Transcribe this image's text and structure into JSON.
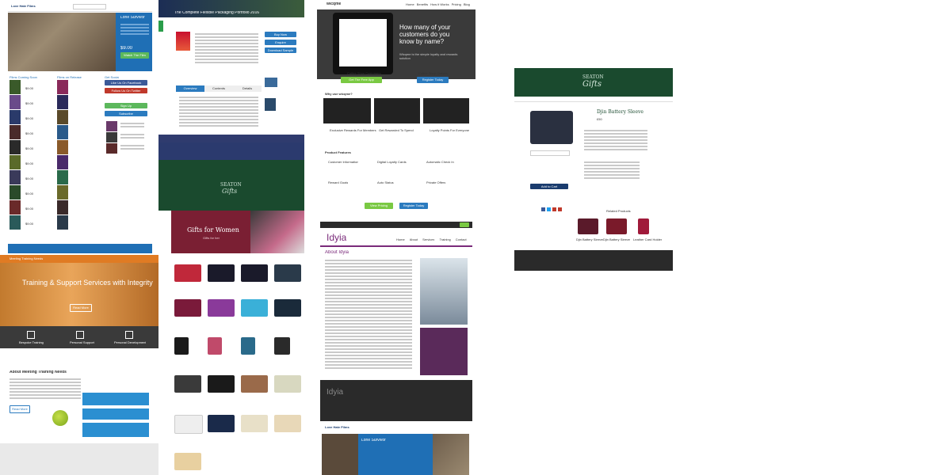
{
  "lovehate": {
    "logo": "Love Hate Films",
    "hero_title": "Lone Survivor",
    "price": "$9.00",
    "hero_button": "Watch The Film",
    "col1_title": "Films Coming Soon",
    "col2_title": "Films on Release",
    "col3_title": "Get Social",
    "prices": [
      "$9.00",
      "$9.00",
      "$9.00",
      "$9.00",
      "$9.00",
      "$9.00",
      "$9.00",
      "$9.00",
      "$9.00",
      "$9.00",
      "$9.00",
      "$9.00"
    ],
    "social_buttons": [
      "Like Us On Facebook",
      "Follow Us On Twitter",
      "Sign Up",
      "Subscribe"
    ]
  },
  "packaging": {
    "heading": "The Complete Flexible Packaging Portfolio 2016",
    "tabs": [
      "Overview",
      "Contents",
      "Details"
    ],
    "buttons": [
      "Buy Now",
      "Enquire",
      "Download Sample"
    ]
  },
  "wicqme": {
    "logo": "wicqme",
    "nav": [
      "Home",
      "Benefits",
      "How it Works",
      "Pricing",
      "Blog",
      "Get Started"
    ],
    "headline": "How many of your customers do you know by name?",
    "sub": "Wicqme is the simple loyalty and rewards solution",
    "btn_customers": "Get The Free App",
    "btn_shops": "Register Today",
    "lbl_customers": "Coffee Shop Customers",
    "lbl_shops": "Coffee Shop Owners",
    "section1": "Why use wicqme?",
    "features": [
      "Exclusive Rewards For Members",
      "Get Rewarded To Spend",
      "Loyalty Points For Everyone"
    ],
    "section2": "Product Features",
    "pf": [
      "Customer Information",
      "Digital Loyalty Cards",
      "Automatic Check In",
      "Reward Goals",
      "Auto Status",
      "Private Offers"
    ],
    "cta1": "View Pricing",
    "cta2": "Register Today"
  },
  "training": {
    "logo": "Meeting Training Needs",
    "hero": "Training & Support Services with Integrity",
    "services": [
      "Bespoke Training",
      "Personal Support",
      "Personal Development"
    ],
    "about": "About Meeting Training Needs",
    "more_button": "Read More"
  },
  "seaton_small": {
    "logo_line1": "SEATON",
    "logo_line2": "Gifts"
  },
  "gifts_for_women": {
    "title": "Gifts for Women",
    "subtitle": "Gifts for her"
  },
  "idyia": {
    "logo": "Idyia",
    "nav": [
      "Home",
      "About",
      "Services",
      "Training",
      "Contact"
    ],
    "heading": "About Idyia",
    "footer_logo": "Idyia"
  },
  "lovehate2": {
    "logo": "Love Hate Films",
    "hero_title": "Lone Survivor"
  },
  "seaton_product": {
    "logo_line1": "SEATON",
    "logo_line2": "Gifts",
    "product_title": "Djin Battery Sleeve",
    "price": "£50",
    "add_button": "Add to Cart",
    "related_title": "Related Products",
    "related": [
      "Djin Battery Sleeve",
      "Djin Battery Sleeve",
      "Leather Card Holder"
    ]
  },
  "colors": {
    "dark_green": "#1a4a2e",
    "blue": "#2b7bbf",
    "orange": "#e07b23",
    "purple": "#7a2a7a",
    "maroon": "#7a1f33",
    "wicqme_green": "#7ac943"
  }
}
